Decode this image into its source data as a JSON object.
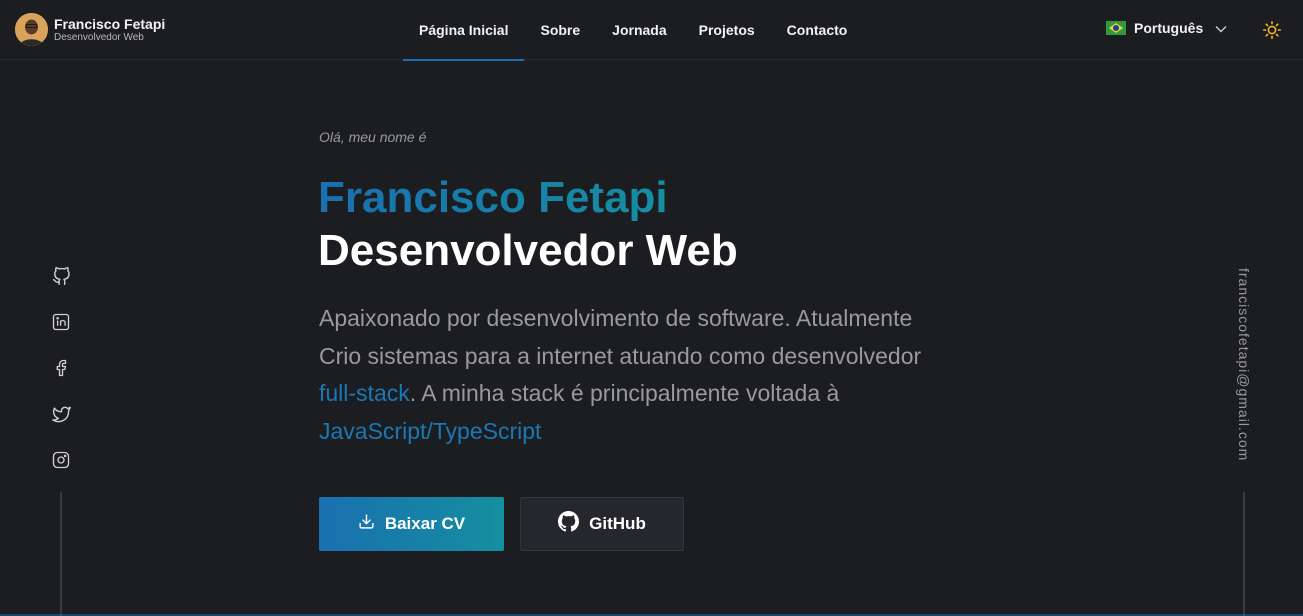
{
  "brand": {
    "name": "Francisco Fetapi",
    "subtitle": "Desenvolvedor Web"
  },
  "nav": {
    "items": [
      {
        "label": "Página Inicial",
        "active": true
      },
      {
        "label": "Sobre",
        "active": false
      },
      {
        "label": "Jornada",
        "active": false
      },
      {
        "label": "Projetos",
        "active": false
      },
      {
        "label": "Contacto",
        "active": false
      }
    ]
  },
  "language": {
    "selected": "Português",
    "flag": "brazil-flag"
  },
  "theme": {
    "icon": "sun-icon"
  },
  "socials": [
    "github-icon",
    "linkedin-icon",
    "facebook-icon",
    "twitter-icon",
    "instagram-icon"
  ],
  "email": "franciscofetapi@gmail.com",
  "hero": {
    "greeting": "Olá, meu nome é",
    "name": "Francisco Fetapi",
    "role": "Desenvolvedor Web",
    "desc_part1": "Apaixonado por desenvolvimento de software. Atualmente Crio sistemas para a internet atuando como desenvolvedor ",
    "desc_hl1": "full-stack",
    "desc_part2": ". A minha stack é principalmente voltada à ",
    "desc_hl2": "JavaScript/TypeScript"
  },
  "buttons": {
    "cv": "Baixar CV",
    "github": "GitHub"
  },
  "colors": {
    "accent": "#1a6fb0",
    "accent2": "#148f9f",
    "background": "#1c1d21",
    "muted": "#9a9a9a"
  }
}
